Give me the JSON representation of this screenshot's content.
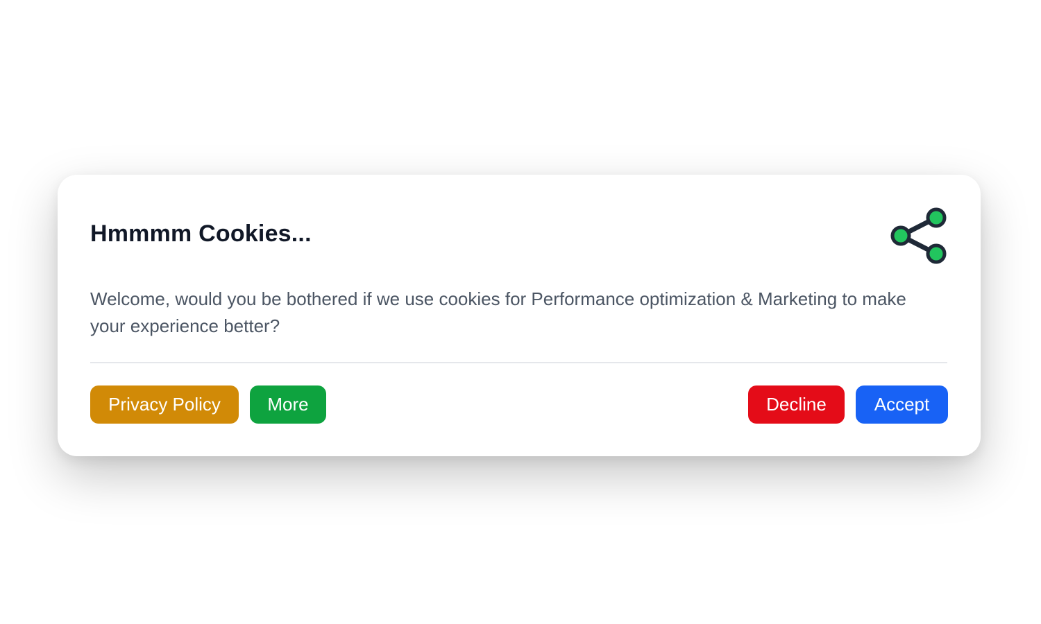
{
  "dialog": {
    "title": "Hmmmm Cookies...",
    "message": "Welcome, would you be bothered if we use cookies for Performance optimization & Marketing to make your experience better?",
    "share_icon": "share-icon"
  },
  "buttons": {
    "privacy_policy": "Privacy Policy",
    "more": "More",
    "decline": "Decline",
    "accept": "Accept"
  },
  "colors": {
    "privacy_policy": "#d18a07",
    "more": "#0ea33f",
    "decline": "#e40c18",
    "accept": "#1862f5",
    "share_icon_fill": "#22c55e",
    "title": "#111827"
  }
}
